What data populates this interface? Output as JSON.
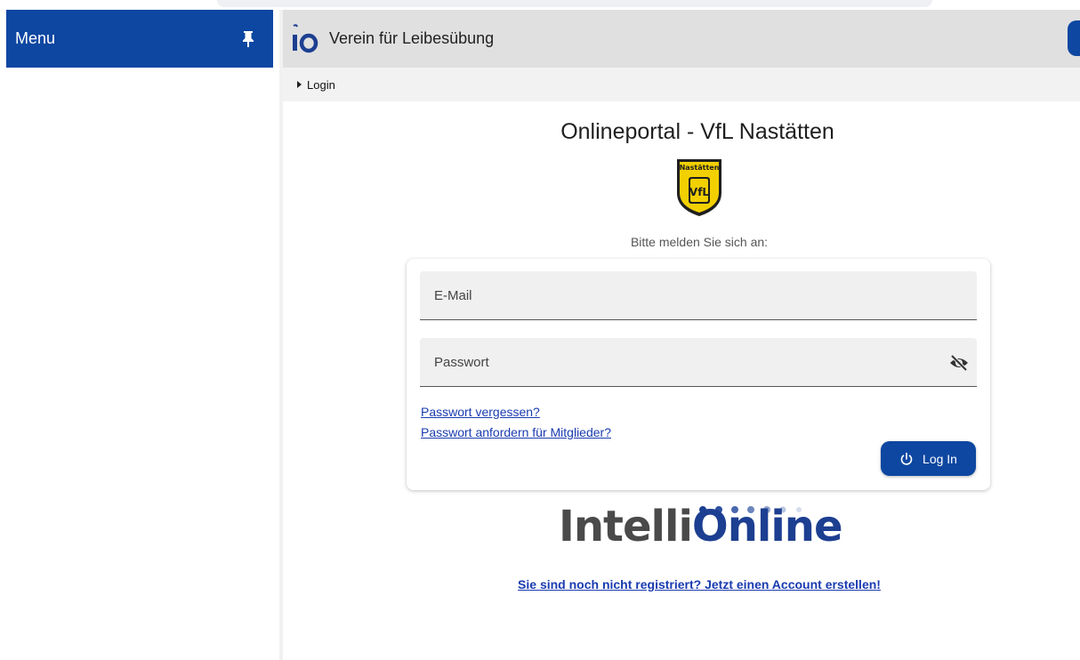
{
  "sidebar": {
    "title": "Menu",
    "pin_icon": "pin-icon"
  },
  "header": {
    "logo": "io",
    "title": "Verein für Leibesübung"
  },
  "breadcrumb": {
    "label": "Login"
  },
  "main": {
    "title": "Onlineportal - VfL Nastätten",
    "club_logo_text": [
      "Nastätten",
      "VfL"
    ],
    "prompt": "Bitte melden Sie sich an:"
  },
  "login_form": {
    "email_placeholder": "E-Mail",
    "email_value": "",
    "password_placeholder": "Passwort",
    "password_value": "",
    "eye_icon": "eye-off-icon",
    "forgot_link": "Passwort vergessen?",
    "request_link": "Passwort anfordern für Mitglieder?",
    "login_button": "Log In",
    "login_icon": "power-icon"
  },
  "brand_logo": {
    "part1": "Intelli",
    "part2": "Online"
  },
  "register_link": "Sie sind noch nicht registriert? Jetzt einen Account erstellen!",
  "colors": {
    "primary": "#0d47a1",
    "link": "#1a3bb0",
    "header_bg": "#e0e0e0"
  }
}
